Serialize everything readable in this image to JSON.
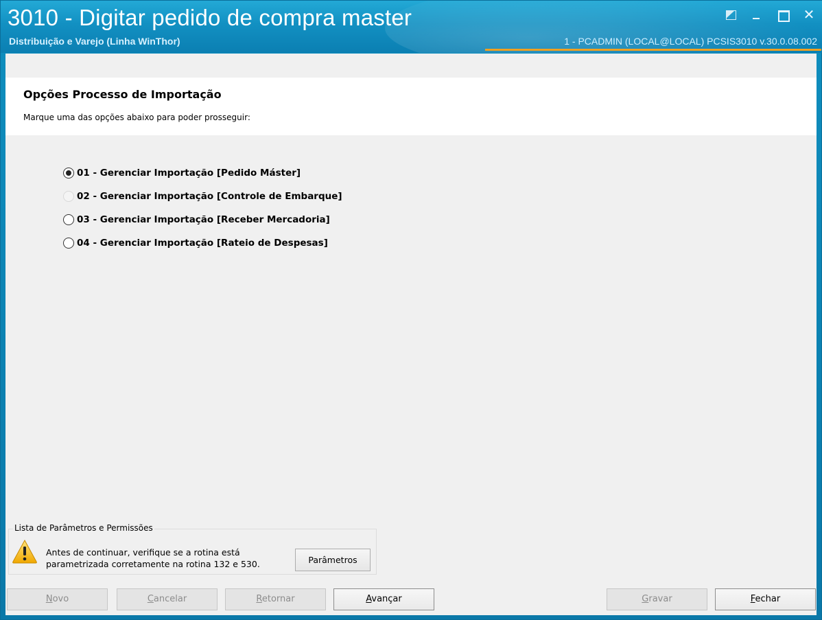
{
  "window": {
    "title": "3010 - Digitar pedido de compra master",
    "subtitle": "Distribuição e Varejo (Linha WinThor)",
    "user_info": "1 - PCADMIN (LOCAL@LOCAL)   PCSIS3010  v.30.0.08.002"
  },
  "header": {
    "title": "Opções Processo de Importação",
    "description": "Marque uma das opções abaixo para poder prosseguir:"
  },
  "options": [
    {
      "label": "01 - Gerenciar Importação [Pedido Máster]",
      "selected": true,
      "enabled": true
    },
    {
      "label": "02 - Gerenciar Importação [Controle de Embarque]",
      "selected": false,
      "enabled": false
    },
    {
      "label": "03 - Gerenciar Importação [Receber Mercadoria]",
      "selected": false,
      "enabled": true
    },
    {
      "label": "04 - Gerenciar Importação [Rateio de Despesas]",
      "selected": false,
      "enabled": true
    }
  ],
  "params": {
    "legend": "Lista de Parâmetros e Permissões",
    "line1": "Antes de continuar, verifique se a rotina está",
    "line2": "parametrizada corretamente na rotina 132 e 530.",
    "button_label": "Parâmetros"
  },
  "buttons": {
    "novo": {
      "first": "N",
      "rest": "ovo"
    },
    "cancelar": {
      "first": "C",
      "rest": "ancelar"
    },
    "retornar": {
      "first": "R",
      "rest": "etornar"
    },
    "avancar": {
      "first": "A",
      "rest": "vançar"
    },
    "gravar": {
      "first": "G",
      "rest": "ravar"
    },
    "fechar": {
      "first": "F",
      "rest": "echar"
    }
  },
  "colors": {
    "titlebar": "#1290c2",
    "accent_line": "#f0a020",
    "warning": "#f5b800"
  },
  "icons": [
    "restore-icon",
    "minimize-icon",
    "maximize-icon",
    "close-icon",
    "warning-icon"
  ]
}
